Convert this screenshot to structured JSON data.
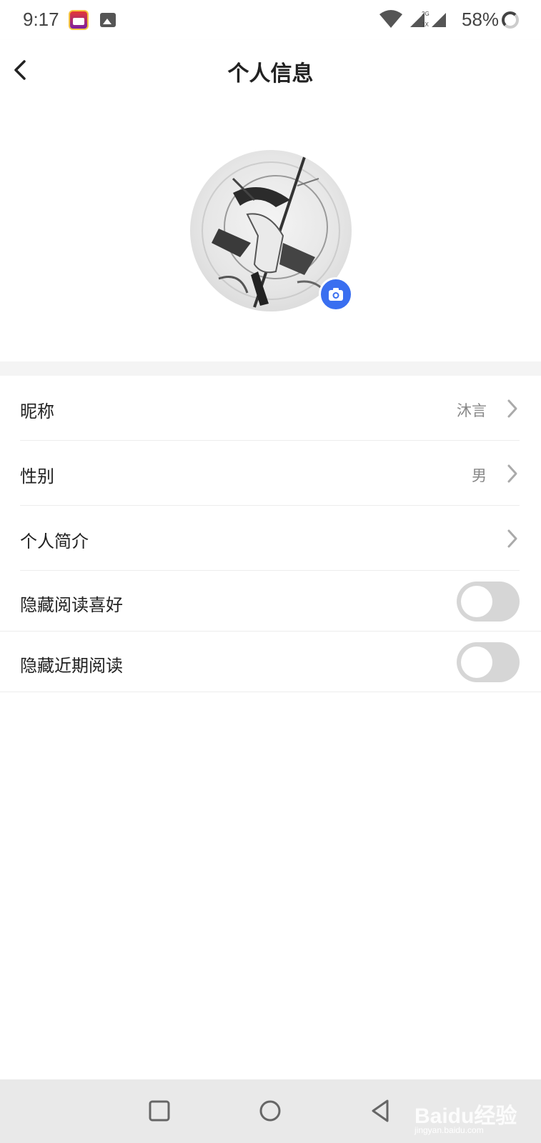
{
  "status_bar": {
    "time": "9:17",
    "signal_label_top": "2G",
    "signal_label_bottom": "1X",
    "battery": "58%",
    "icons": [
      "app-icon",
      "gallery-icon",
      "wifi-icon",
      "signal-icon",
      "battery-icon"
    ]
  },
  "header": {
    "title": "个人信息",
    "back_icon": "chevron-left-icon"
  },
  "avatar": {
    "camera_icon": "camera-icon",
    "accent_color": "#3a6ff0"
  },
  "list": {
    "nickname": {
      "label": "昵称",
      "value": "沐言"
    },
    "gender": {
      "label": "性别",
      "value": "男"
    },
    "bio": {
      "label": "个人简介"
    },
    "hide_preferences": {
      "label": "隐藏阅读喜好",
      "enabled": false
    },
    "hide_recent": {
      "label": "隐藏近期阅读",
      "enabled": false
    }
  },
  "nav_bar": {
    "buttons": [
      "recents-square-icon",
      "home-circle-icon",
      "back-triangle-icon"
    ],
    "watermark": "Baidu经验",
    "watermark_url": "jingyan.baidu.com"
  }
}
